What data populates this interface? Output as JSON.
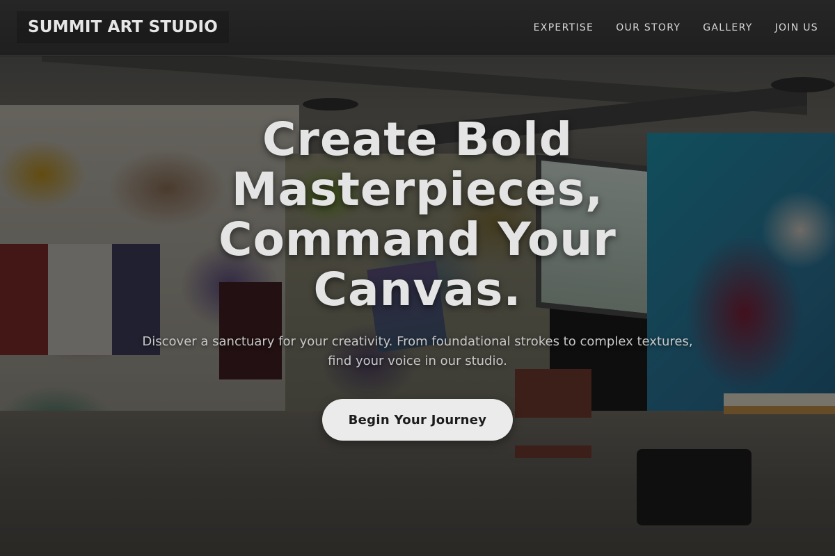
{
  "header": {
    "logo_text": "SUMMIT ART STUDIO",
    "nav": [
      {
        "label": "EXPERTISE"
      },
      {
        "label": "OUR STORY"
      },
      {
        "label": "GALLERY"
      },
      {
        "label": "JOIN US"
      }
    ]
  },
  "hero": {
    "title": "Create Bold Masterpieces, Command Your Canvas.",
    "subtitle": "Discover a sanctuary for your creativity. From foundational strokes to complex textures, find your voice in our studio.",
    "cta_label": "Begin Your Journey",
    "background_image": "graffiti-art-studio"
  },
  "colors": {
    "header_bg": "#232323",
    "text_light": "#e4e4e4",
    "button_bg": "#ebebeb",
    "button_text": "#1c1c1c"
  }
}
